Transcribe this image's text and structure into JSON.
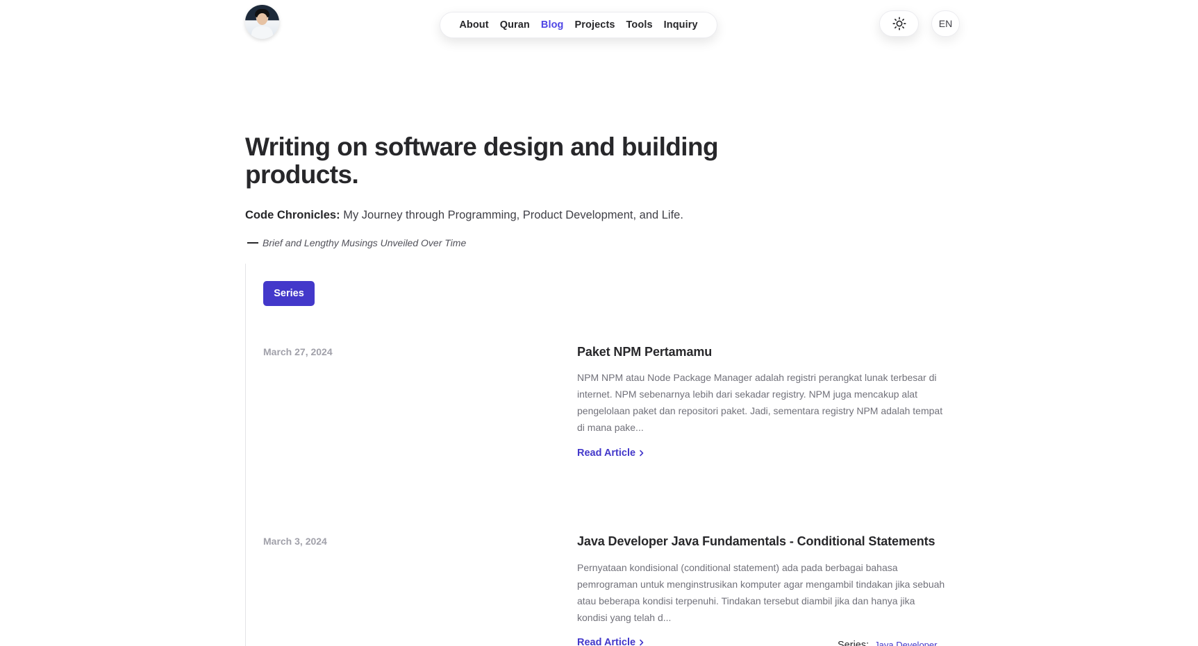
{
  "header": {
    "nav_items": [
      {
        "label": "About",
        "active": false
      },
      {
        "label": "Quran",
        "active": false
      },
      {
        "label": "Blog",
        "active": true
      },
      {
        "label": "Projects",
        "active": false
      },
      {
        "label": "Tools",
        "active": false
      },
      {
        "label": "Inquiry",
        "active": false
      }
    ],
    "theme_icon": "sun-icon",
    "language": "EN"
  },
  "hero": {
    "title": "Writing on software design and building products.",
    "subtitle_bold": "Code Chronicles:",
    "subtitle_rest": " My Journey through Programming, Product Development, and Life.",
    "quote": "Brief and Lengthy Musings Unveiled Over Time"
  },
  "filters": {
    "series_label": "Series"
  },
  "posts": [
    {
      "date": "March 27, 2024",
      "title": "Paket NPM Pertamamu",
      "excerpt": "NPM NPM atau Node Package Manager adalah registri perangkat lunak terbesar di internet. NPM sebenarnya lebih dari sekadar registry. NPM juga mencakup alat pengelolaan paket dan repositori paket. Jadi, sementara registry NPM adalah tempat di mana pake...",
      "read_label": "Read Article"
    },
    {
      "date": "March 3, 2024",
      "title": "Java Developer Java Fundamentals - Conditional Statements",
      "excerpt": "Pernyataan kondisional (conditional statement) ada pada berbagai bahasa pemrograman untuk menginstrusikan komputer agar mengambil tindakan jika sebuah atau beberapa kondisi terpenuhi. Tindakan tersebut diambil jika dan hanya jika kondisi yang telah d...",
      "read_label": "Read Article",
      "series_label": "Series:",
      "series_name": "Java Developer"
    }
  ],
  "colors": {
    "accent": "#4338ca",
    "nav_active": "#4f46e5",
    "text": "#27272a",
    "muted": "#71717a"
  }
}
